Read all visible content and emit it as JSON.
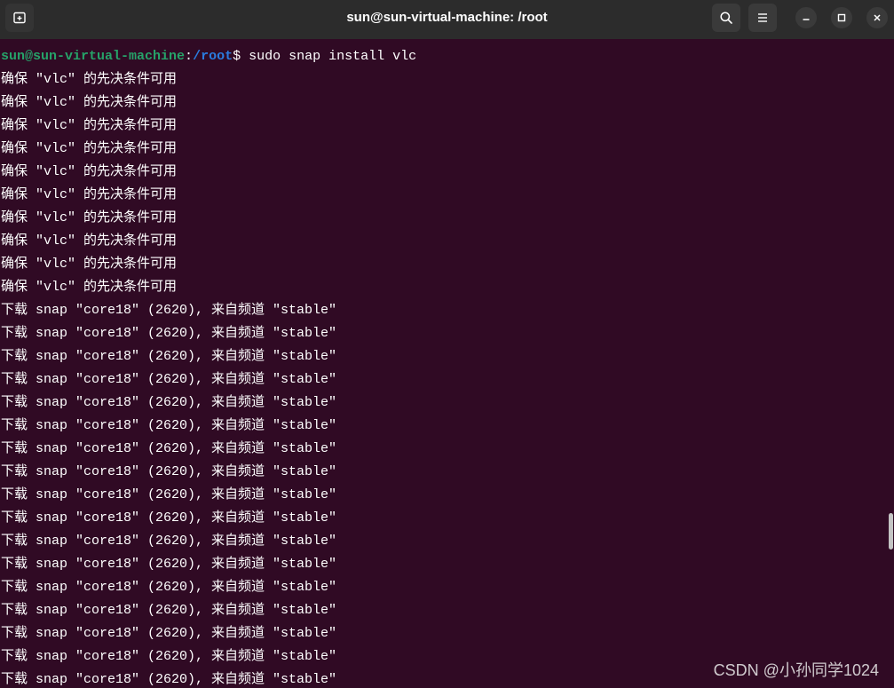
{
  "window": {
    "title": "sun@sun-virtual-machine: /root"
  },
  "header_buttons": {
    "new_tab_icon": "new-tab-icon",
    "search_icon": "search-icon",
    "menu_icon": "hamburger-menu-icon",
    "minimize_icon": "minimize-icon",
    "maximize_icon": "maximize-icon",
    "close_icon": "close-icon"
  },
  "terminal": {
    "prompt": {
      "user_host": "sun@sun-virtual-machine",
      "separator": ":",
      "path": "/root",
      "symbol": "$",
      "command": "sudo snap install vlc"
    },
    "output_lines": [
      "确保 \"vlc\" 的先决条件可用",
      "确保 \"vlc\" 的先决条件可用",
      "确保 \"vlc\" 的先决条件可用",
      "确保 \"vlc\" 的先决条件可用",
      "确保 \"vlc\" 的先决条件可用",
      "确保 \"vlc\" 的先决条件可用",
      "确保 \"vlc\" 的先决条件可用",
      "确保 \"vlc\" 的先决条件可用",
      "确保 \"vlc\" 的先决条件可用",
      "确保 \"vlc\" 的先决条件可用",
      "下载 snap \"core18\" (2620), 来自频道 \"stable\"",
      "下载 snap \"core18\" (2620), 来自频道 \"stable\"",
      "下载 snap \"core18\" (2620), 来自频道 \"stable\"",
      "下载 snap \"core18\" (2620), 来自频道 \"stable\"",
      "下载 snap \"core18\" (2620), 来自频道 \"stable\"",
      "下载 snap \"core18\" (2620), 来自频道 \"stable\"",
      "下载 snap \"core18\" (2620), 来自频道 \"stable\"",
      "下载 snap \"core18\" (2620), 来自频道 \"stable\"",
      "下载 snap \"core18\" (2620), 来自频道 \"stable\"",
      "下载 snap \"core18\" (2620), 来自频道 \"stable\"",
      "下载 snap \"core18\" (2620), 来自频道 \"stable\"",
      "下载 snap \"core18\" (2620), 来自频道 \"stable\"",
      "下载 snap \"core18\" (2620), 来自频道 \"stable\"",
      "下载 snap \"core18\" (2620), 来自频道 \"stable\"",
      "下载 snap \"core18\" (2620), 来自频道 \"stable\"",
      "下载 snap \"core18\" (2620), 来自频道 \"stable\"",
      "下载 snap \"core18\" (2620), 来自频道 \"stable\""
    ]
  },
  "watermark": {
    "text": "CSDN @小孙同学1024"
  },
  "colors": {
    "terminal_background": "#300a24",
    "titlebar_background": "#2c2c2c",
    "button_background": "#3a3a3a",
    "text": "#ffffff",
    "prompt_user_host": "#26a269",
    "prompt_path": "#2a7bde",
    "scrollbar_thumb": "#c4c4c4"
  }
}
